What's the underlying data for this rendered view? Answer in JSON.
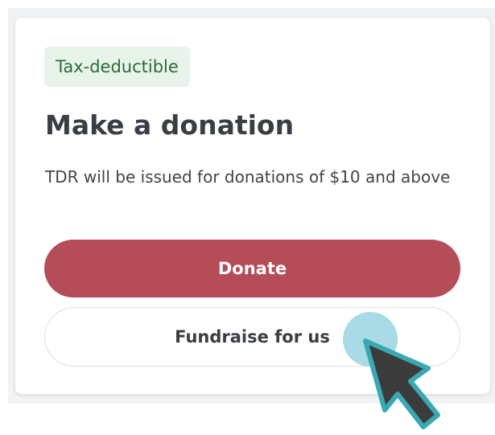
{
  "card": {
    "badge": "Tax-deductible",
    "title": "Make a donation",
    "description": "TDR will be issued for donations of $10 and above"
  },
  "actions": {
    "donate_label": "Donate",
    "fundraise_label": "Fundraise for us"
  },
  "icons": {
    "cursor": "cursor-icon",
    "click_indicator": "click-indicator-icon"
  },
  "colors": {
    "donate_button": "#b44d57",
    "badge_bg": "#e8f4ea",
    "badge_text": "#2d6a3a",
    "cursor_fill": "#3b3b3b",
    "cursor_outline": "#38a9b3",
    "click_highlight": "#a8dbe5"
  }
}
